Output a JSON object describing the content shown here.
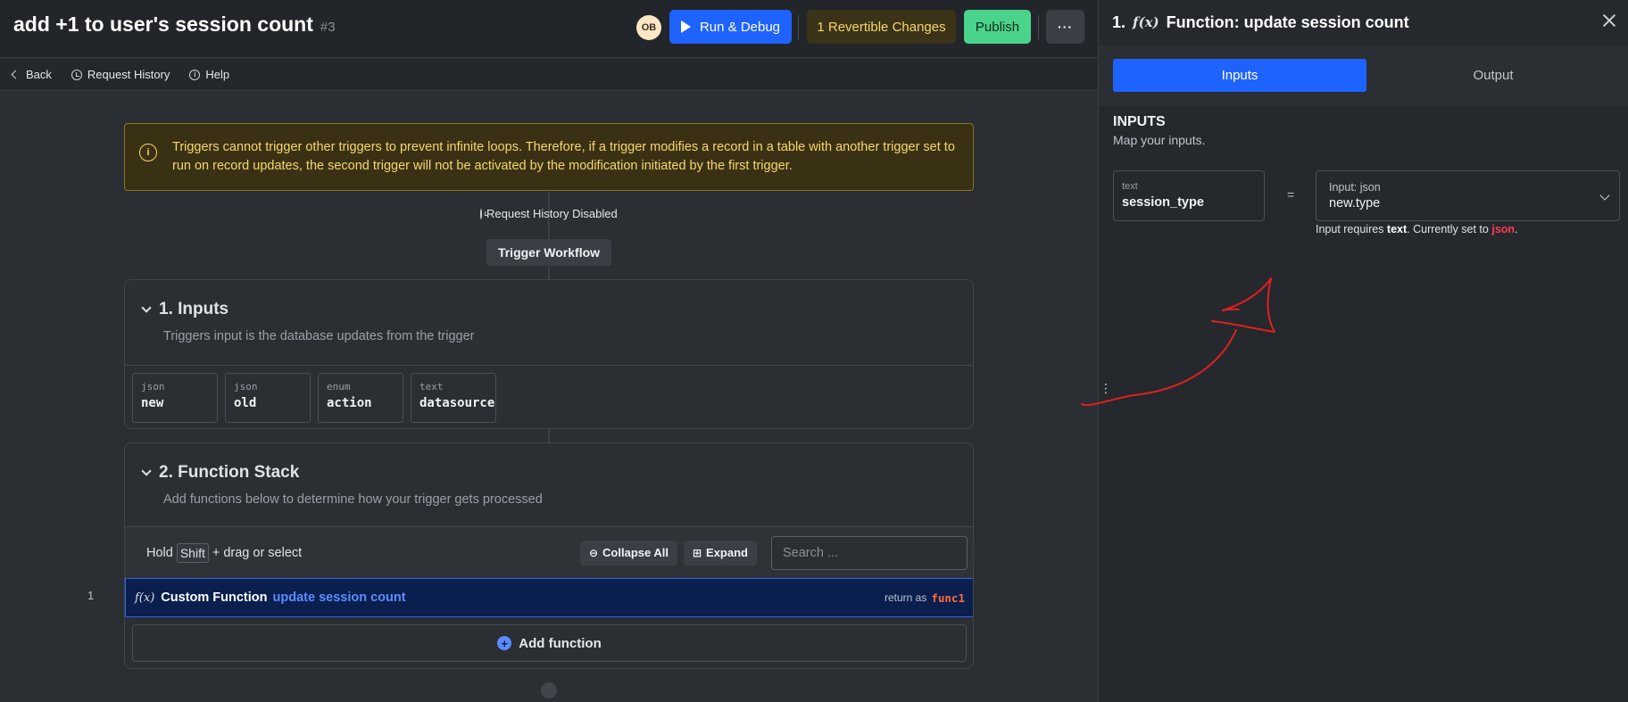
{
  "header": {
    "title": "add +1 to user's session count",
    "id": "#3",
    "avatar": "OB",
    "run_debug": "Run & Debug",
    "revertible": "1 Revertible Changes",
    "publish": "Publish",
    "more": "···"
  },
  "subnav": {
    "back": "Back",
    "request_history": "Request History",
    "help": "Help"
  },
  "warning": {
    "text": "Triggers cannot trigger other triggers to prevent infinite loops. Therefore, if a trigger modifies a record in a table with another trigger set to run on record updates, the second trigger will not be activated by the modification initiated by the first trigger."
  },
  "workflow": {
    "request_history_disabled": "Request History Disabled",
    "trigger_workflow": "Trigger Workflow"
  },
  "inputs_card": {
    "title": "1. Inputs",
    "subtitle": "Triggers input is the database updates from the trigger",
    "items": [
      {
        "type": "json",
        "name": "new"
      },
      {
        "type": "json",
        "name": "old"
      },
      {
        "type": "enum",
        "name": "action"
      },
      {
        "type": "text",
        "name": "datasource"
      }
    ]
  },
  "function_stack": {
    "title": "2. Function Stack",
    "subtitle": "Add functions below to determine how your trigger gets processed",
    "hold": "Hold",
    "shift": "Shift",
    "drag_hint": "+ drag or select",
    "collapse_all": "Collapse All",
    "expand": "Expand",
    "search_placeholder": "Search ...",
    "row_number": "1",
    "function": {
      "icon": "f(x)",
      "name": "Custom Function",
      "link": "update session count",
      "return_label": "return as",
      "return_var": "func1"
    },
    "add_function": "Add function"
  },
  "panel": {
    "step": "1.",
    "icon": "f(x)",
    "title": "Function: update session count",
    "tabs": [
      "Inputs",
      "Output"
    ],
    "inputs_heading": "INPUTS",
    "inputs_sub": "Map your inputs.",
    "mapping": {
      "left_type": "text",
      "left_name": "session_type",
      "equals": "=",
      "right_label": "Input: json",
      "right_value": "new.type"
    },
    "hint": {
      "prefix": "Input requires",
      "required": "text",
      "middle": ". Currently set to",
      "current": "json",
      "suffix": "."
    }
  },
  "colors": {
    "accent": "#1f63ff",
    "publish": "#4ad38b",
    "warning": "#f6d76c",
    "error": "#ff3b53",
    "annotation": "#e0201f"
  }
}
